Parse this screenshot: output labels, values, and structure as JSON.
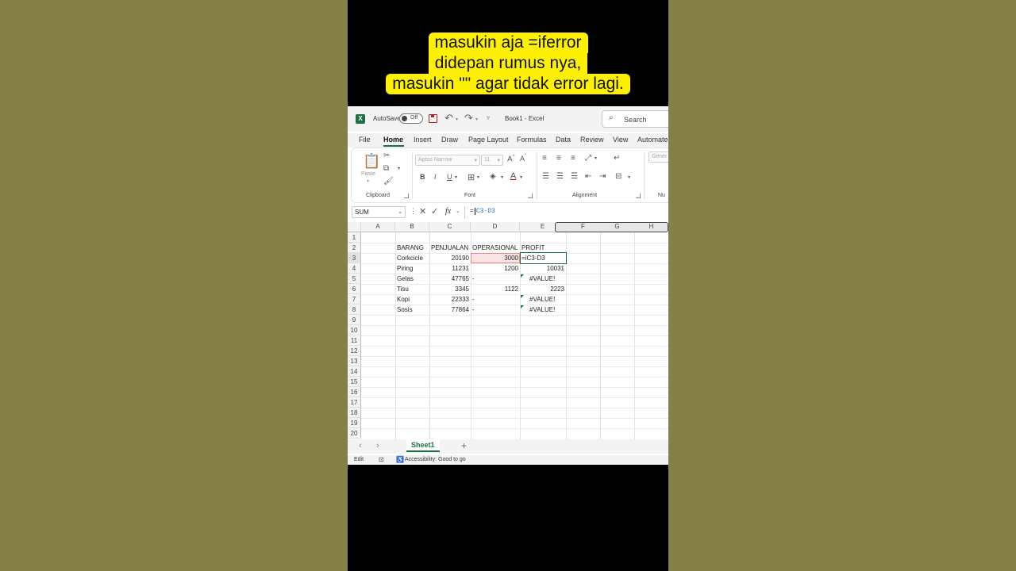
{
  "caption": {
    "lines": [
      "masukin aja =iferror",
      "didepan rumus nya,",
      "masukin \"\" agar tidak error lagi."
    ]
  },
  "titlebar": {
    "autosave_label": "AutoSave",
    "toggle_state": "Off",
    "workbook": "Book1",
    "separator": "-",
    "app": "Excel",
    "search_placeholder": "Search"
  },
  "menu_tabs": [
    "File",
    "Home",
    "Insert",
    "Draw",
    "Page Layout",
    "Formulas",
    "Data",
    "Review",
    "View",
    "Automate"
  ],
  "active_tab": "Home",
  "ribbon": {
    "clipboard": {
      "paste_label": "Paste",
      "group_label": "Clipboard"
    },
    "font": {
      "font_name": "Aptos Narrow",
      "font_size": "11",
      "bold": "B",
      "italic": "I",
      "underline": "U",
      "group_label": "Font"
    },
    "alignment": {
      "group_label": "Alignment"
    },
    "number": {
      "format": "Gener",
      "group_label": "Nu"
    }
  },
  "formula_bar": {
    "name_box": "SUM",
    "formula_prefix": "=",
    "formula_ref": "C3-D3"
  },
  "grid": {
    "columns": [
      "A",
      "B",
      "C",
      "D",
      "E",
      "F",
      "G",
      "H"
    ],
    "rows": [
      "1",
      "2",
      "3",
      "4",
      "5",
      "6",
      "7",
      "8",
      "9",
      "10",
      "11",
      "12",
      "13",
      "14",
      "15",
      "16",
      "17",
      "18",
      "19",
      "20"
    ],
    "headers": {
      "b": "BARANG",
      "c": "PENJUALAN",
      "d": "OPERASIONAL",
      "e": "PROFIT"
    },
    "data": [
      {
        "barang": "Corkcicle",
        "penjualan": "20190",
        "operasional": "3000",
        "profit": "=iC3-D3"
      },
      {
        "barang": "Piring",
        "penjualan": "11231",
        "operasional": "1200",
        "profit": "10031"
      },
      {
        "barang": "Gelas",
        "penjualan": "47765",
        "operasional": "-",
        "profit": "#VALUE!"
      },
      {
        "barang": "Tisu",
        "penjualan": "3345",
        "operasional": "1122",
        "profit": "2223"
      },
      {
        "barang": "Kopi",
        "penjualan": "22333",
        "operasional": "-",
        "profit": "#VALUE!"
      },
      {
        "barang": "Sosis",
        "penjualan": "77864",
        "operasional": "-",
        "profit": "#VALUE!"
      }
    ]
  },
  "sheets": {
    "active": "Sheet1"
  },
  "status": {
    "mode": "Edit",
    "accessibility": "Accessibility: Good to go"
  },
  "colors": {
    "accent": "#1d6f42",
    "caption_bg": "#fdf000",
    "outer_bg": "#857f48"
  }
}
